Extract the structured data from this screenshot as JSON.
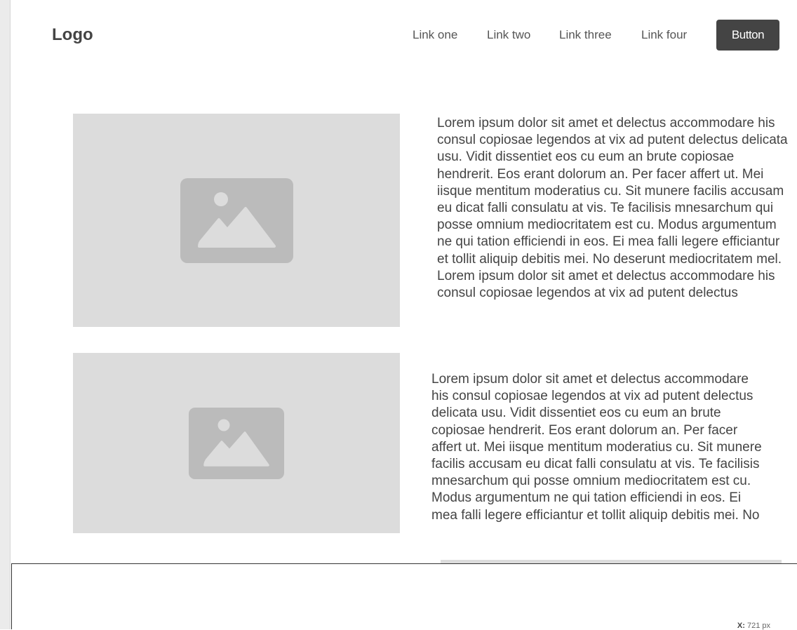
{
  "header": {
    "logo": "Logo",
    "nav_links": [
      "Link one",
      "Link two",
      "Link three",
      "Link four"
    ],
    "button_label": "Button"
  },
  "sections": [
    {
      "image_icon": "image-placeholder-icon",
      "text": "Lorem ipsum dolor sit amet et delectus accommodare his consul copiosae legendos at vix ad putent delectus delicata usu. Vidit dissentiet eos cu eum an brute copiosae hendrerit. Eos erant dolorum an. Per facer affert ut. Mei iisque mentitum moderatius cu. Sit munere facilis accusam eu dicat falli consulatu at vis. Te facilisis mnesarchum qui posse omnium mediocritatem est cu. Modus argumentum ne qui tation efficiendi in eos. Ei mea falli legere efficiantur et tollit aliquip debitis mei. No deserunt mediocritatem mel. Lorem ipsum dolor sit amet et delectus accommodare his consul copiosae legendos at vix ad putent delectus"
    },
    {
      "image_icon": "image-placeholder-icon",
      "text": "Lorem ipsum dolor sit amet et delectus accommodare his consul copiosae legendos at vix ad putent delectus delicata usu. Vidit dissentiet eos cu eum an brute copiosae hendrerit. Eos erant dolorum an. Per facer affert ut. Mei iisque mentitum moderatius cu. Sit munere facilis accusam eu dicat falli consulatu at vis. Te facilisis mnesarchum qui posse omnium mediocritatem est cu. Modus argumentum ne qui tation efficiendi in eos. Ei mea falli legere efficiantur et tollit aliquip debitis mei. No"
    }
  ],
  "readout": {
    "x_label": "X:",
    "x_value": "721 px"
  },
  "colors": {
    "placeholder_bg": "#dcdcdc",
    "placeholder_icon": "#bbbbbb",
    "button_bg": "#444444",
    "text": "#444444"
  }
}
